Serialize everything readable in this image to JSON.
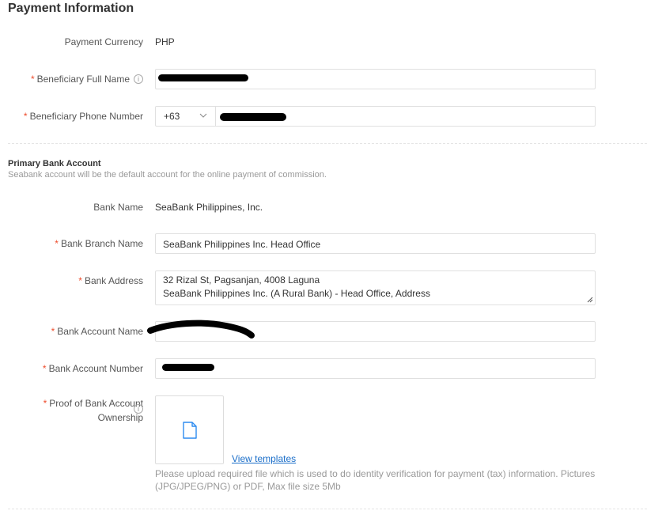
{
  "page": {
    "title": "Payment Information"
  },
  "payment_currency": {
    "label": "Payment Currency",
    "value": "PHP"
  },
  "beneficiary_name": {
    "label": "Beneficiary Full Name",
    "value": ""
  },
  "beneficiary_phone": {
    "label": "Beneficiary Phone Number",
    "country_code": "+63",
    "value": ""
  },
  "primary_bank": {
    "title": "Primary Bank Account",
    "description": "Seabank account will be the default account for the online payment of commission."
  },
  "bank_name": {
    "label": "Bank Name",
    "value": "SeaBank Philippines, Inc."
  },
  "bank_branch": {
    "label": "Bank Branch Name",
    "value": "SeaBank Philippines Inc. Head Office"
  },
  "bank_address": {
    "label": "Bank Address",
    "line1": "32 Rizal St, Pagsanjan, 4008 Laguna",
    "line2": "SeaBank Philippines Inc. (A Rural Bank) - Head Office, Address"
  },
  "bank_account_name": {
    "label": "Bank Account Name",
    "value": ""
  },
  "bank_account_number": {
    "label": "Bank Account Number",
    "value": ""
  },
  "proof": {
    "label_line1": "Proof of Bank Account",
    "label_line2": "Ownership",
    "templates_link": "View templates",
    "hint": "Please upload required file which is used to do identity verification for payment (tax) information. Pictures (JPG/JPEG/PNG) or PDF, Max file size 5Mb"
  },
  "icons": {
    "info": "info-icon",
    "chevron": "chevron-down-icon",
    "file": "file-icon",
    "required": "asterisk"
  },
  "colors": {
    "required": "#ee4d2d",
    "link": "#1a6ec9",
    "file_icon": "#2d8cf0",
    "hint": "#999999"
  }
}
